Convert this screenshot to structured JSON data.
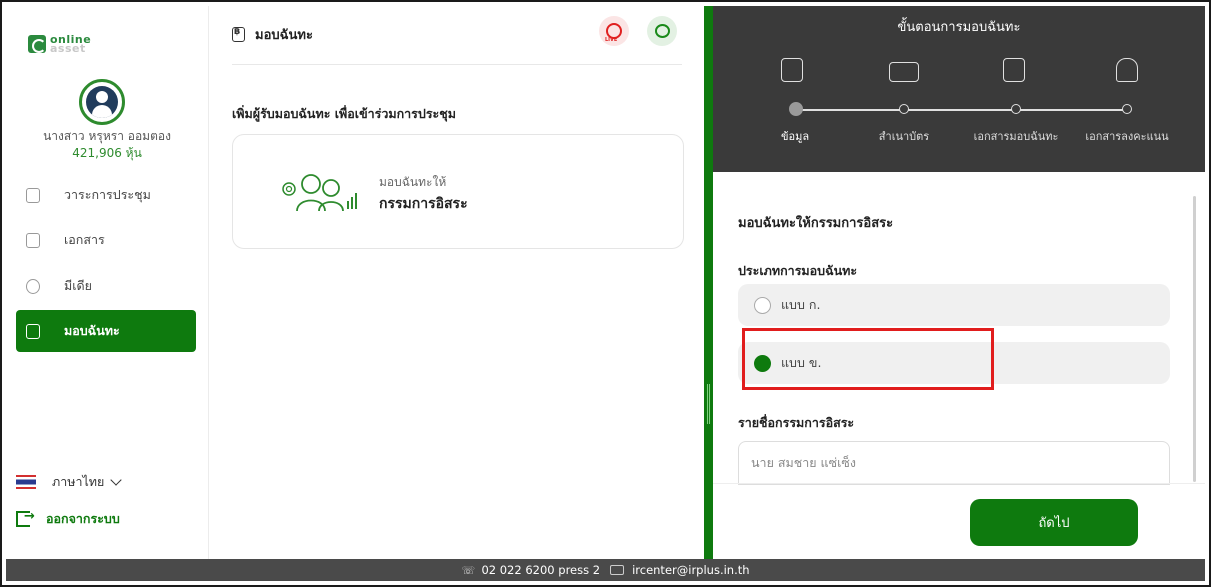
{
  "brand": {
    "logo_top": "online",
    "logo_bottom": "asset"
  },
  "user": {
    "name": "นางสาว หรุหรา ออมตอง",
    "shares": "421,906 หุ้น"
  },
  "sidebar": {
    "items": [
      {
        "label": "วาระการประชุม",
        "icon": "agenda-icon"
      },
      {
        "label": "เอกสาร",
        "icon": "folder-icon"
      },
      {
        "label": "มีเดีย",
        "icon": "play-icon"
      },
      {
        "label": "มอบฉันทะ",
        "icon": "proxy-doc-icon",
        "active": true
      }
    ],
    "language": "ภาษาไทย",
    "logout": "ออกจากระบบ"
  },
  "main": {
    "title": "มอบฉันทะ",
    "section_label": "เพิ่มผู้รับมอบฉันทะ เพื่อเข้าร่วมการประชุม",
    "card": {
      "subtitle": "มอบฉันทะให้",
      "title": "กรรมการอิสระ"
    }
  },
  "steps": {
    "title": "ขั้นตอนการมอบฉันทะ",
    "items": [
      {
        "label": "ข้อมูล",
        "active": true
      },
      {
        "label": "สำเนาบัตร",
        "active": false
      },
      {
        "label": "เอกสารมอบฉันทะ",
        "active": false
      },
      {
        "label": "เอกสารลงคะแนน",
        "active": false
      }
    ]
  },
  "form": {
    "title": "มอบฉันทะให้กรรมการอิสระ",
    "type_label": "ประเภทการมอบฉันทะ",
    "options": [
      {
        "label": "แบบ ก.",
        "selected": false
      },
      {
        "label": "แบบ ข.",
        "selected": true
      }
    ],
    "name_label": "รายชื่อกรรมการอิสระ",
    "name_value": "นาย สมชาย แซ่เซ็ง",
    "next_label": "ถัดไป"
  },
  "footer": {
    "phone": "02 022 6200 press 2",
    "email": "ircenter@irplus.in.th"
  },
  "colors": {
    "primary": "#0e7a0e",
    "header_dark": "#3a3a3a",
    "highlight": "#e11d1d"
  }
}
